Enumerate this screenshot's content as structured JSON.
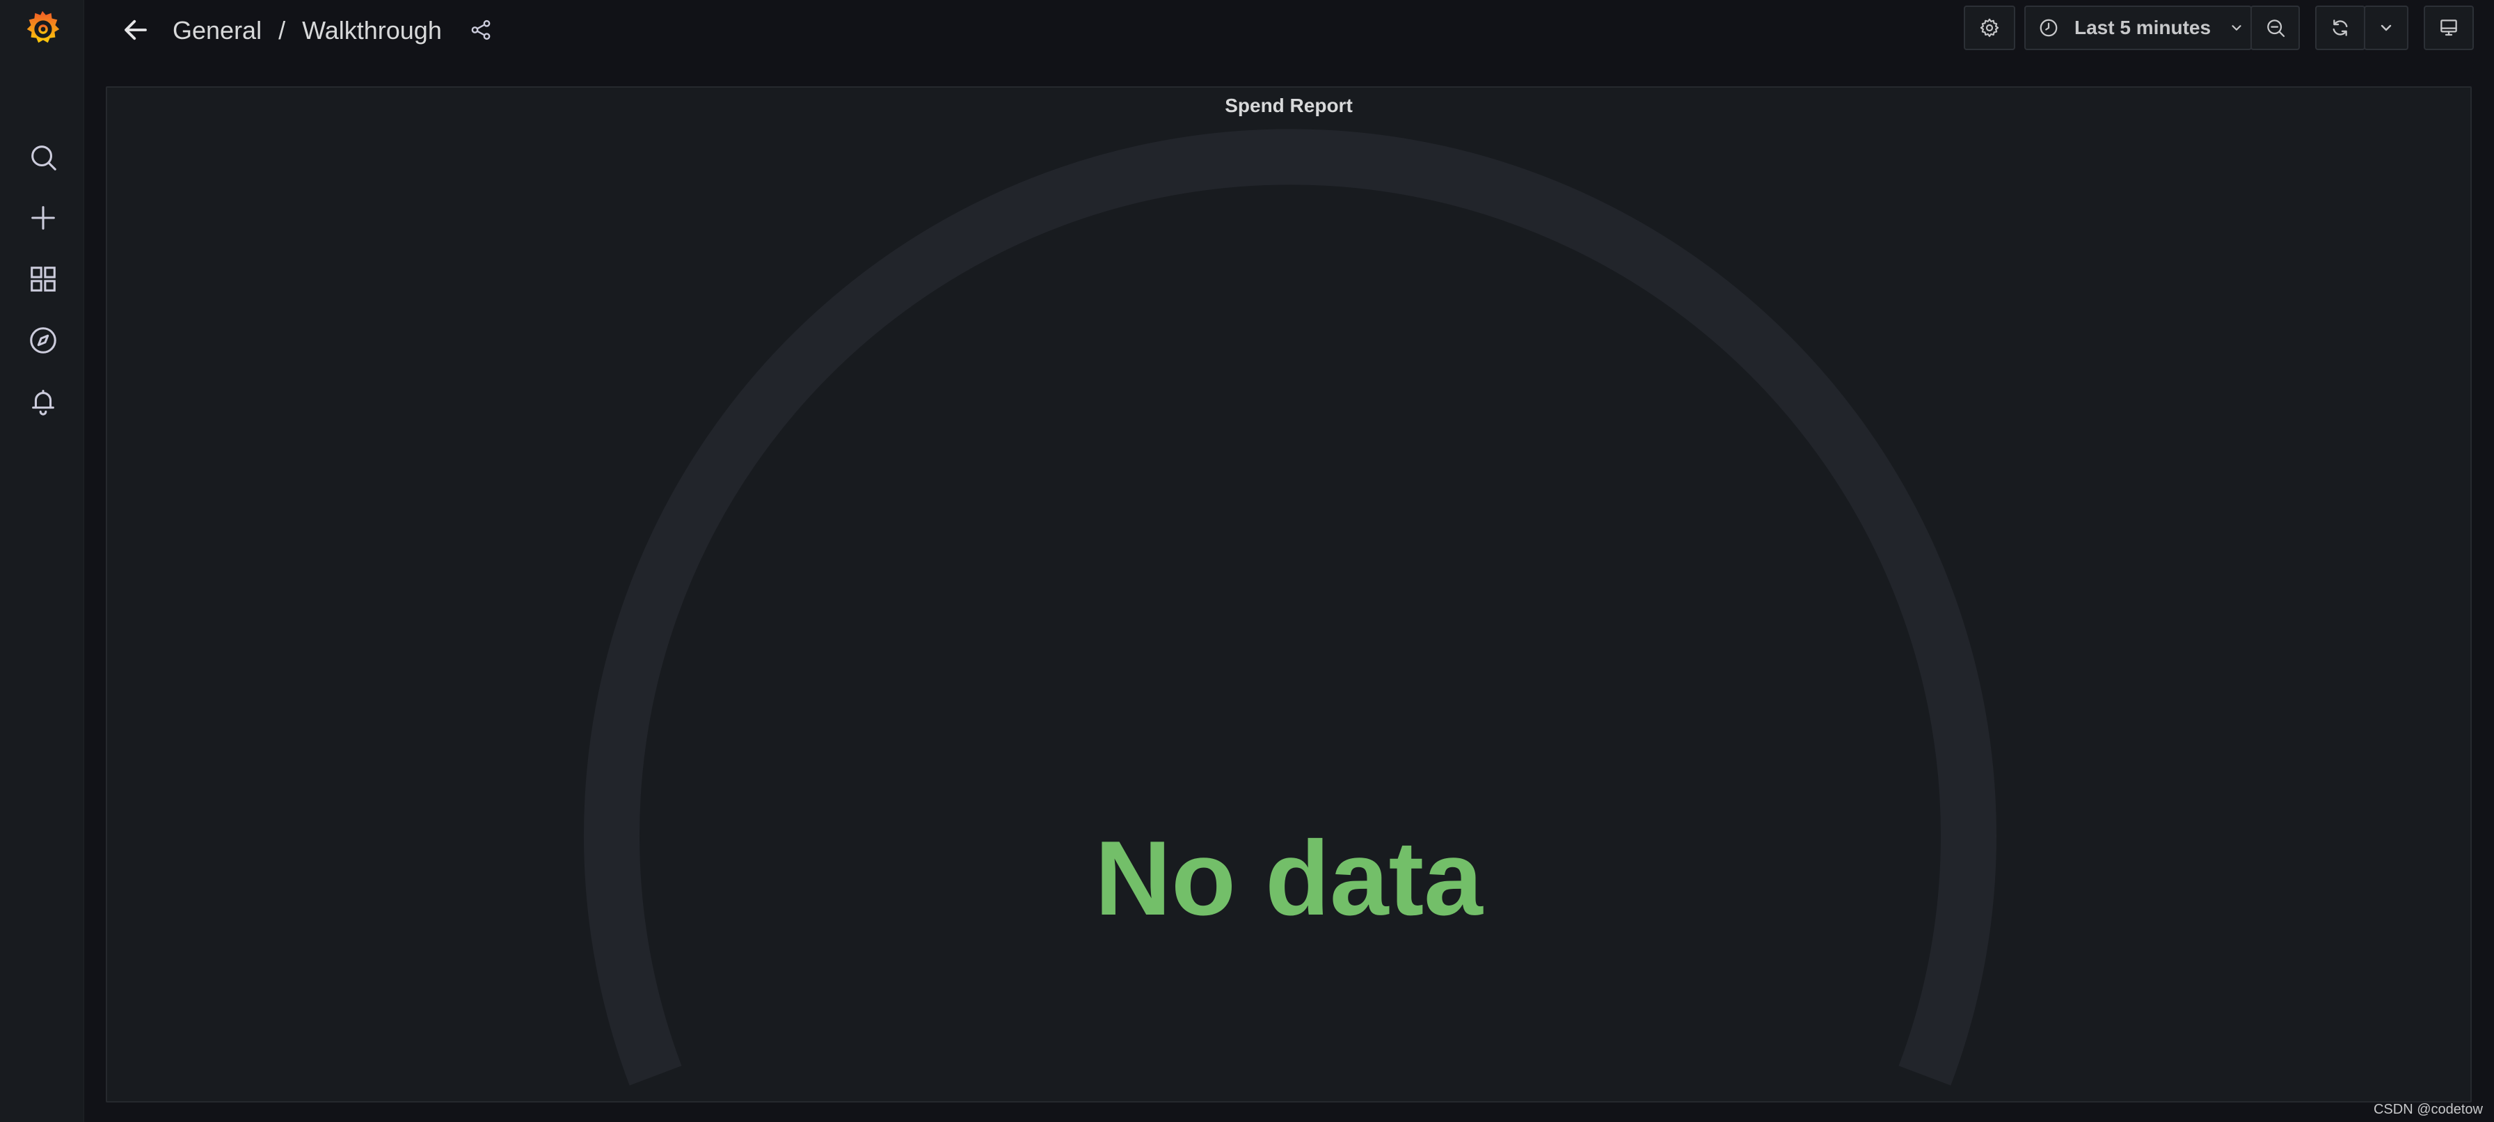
{
  "sidebar": {
    "logo": "grafana-logo",
    "items": [
      {
        "icon": "search-icon",
        "label": "Search"
      },
      {
        "icon": "plus-icon",
        "label": "Create"
      },
      {
        "icon": "dashboards-grid-icon",
        "label": "Dashboards"
      },
      {
        "icon": "compass-icon",
        "label": "Explore"
      },
      {
        "icon": "bell-icon",
        "label": "Alerting"
      }
    ]
  },
  "header": {
    "breadcrumb": [
      "General",
      "Walkthrough"
    ],
    "separator": "/",
    "time_range": "Last 5 minutes"
  },
  "panel": {
    "title": "Spend Report",
    "message": "No data"
  },
  "colors": {
    "background": "#111217",
    "panel": "#181b1f",
    "gauge_track": "#22252b",
    "no_data_text": "#73bf69",
    "logo_orange": "#f05a28"
  },
  "watermark": "CSDN @codetow"
}
